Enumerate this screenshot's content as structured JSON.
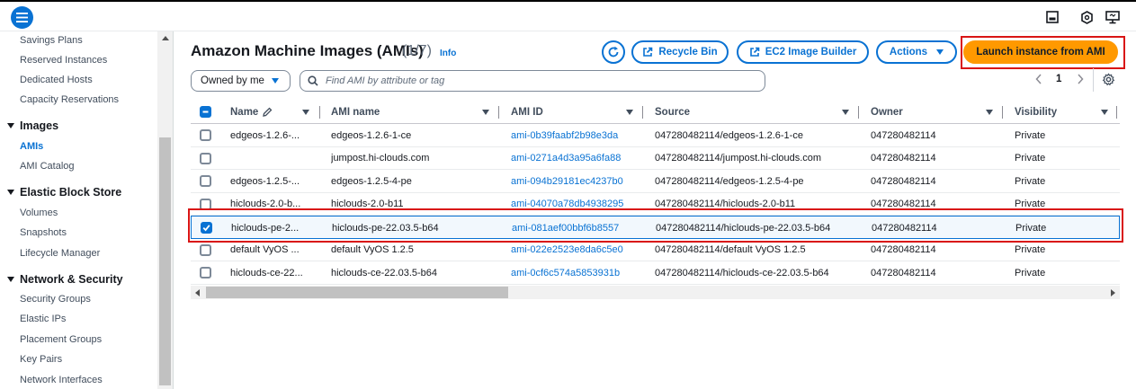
{
  "sidebar": {
    "items_top": [
      "Savings Plans",
      "Reserved Instances",
      "Dedicated Hosts",
      "Capacity Reservations"
    ],
    "images": {
      "title": "Images",
      "items": [
        "AMIs",
        "AMI Catalog"
      ],
      "active": "AMIs"
    },
    "ebs": {
      "title": "Elastic Block Store",
      "items": [
        "Volumes",
        "Snapshots",
        "Lifecycle Manager"
      ]
    },
    "network": {
      "title": "Network & Security",
      "items": [
        "Security Groups",
        "Elastic IPs",
        "Placement Groups",
        "Key Pairs",
        "Network Interfaces"
      ]
    }
  },
  "header": {
    "title": "Amazon Machine Images (AMIs)",
    "count": "(1/7)",
    "info": "Info",
    "buttons": {
      "recycle_bin": "Recycle Bin",
      "image_builder": "EC2 Image Builder",
      "actions": "Actions",
      "launch": "Launch instance from AMI"
    }
  },
  "filter": {
    "owned_by": "Owned by me",
    "search_placeholder": "Find AMI by attribute or tag"
  },
  "pagination": {
    "current_page": "1"
  },
  "table": {
    "columns": [
      "Name",
      "AMI name",
      "AMI ID",
      "Source",
      "Owner",
      "Visibility"
    ],
    "rows": [
      {
        "name": "edgeos-1.2.6-...",
        "ami_name": "edgeos-1.2.6-1-ce",
        "ami_id": "ami-0b39faabf2b98e3da",
        "source": "047280482114/edgeos-1.2.6-1-ce",
        "owner": "047280482114",
        "visibility": "Private",
        "selected": false
      },
      {
        "name": "",
        "ami_name": "jumpost.hi-clouds.com",
        "ami_id": "ami-0271a4d3a95a6fa88",
        "source": "047280482114/jumpost.hi-clouds.com",
        "owner": "047280482114",
        "visibility": "Private",
        "selected": false
      },
      {
        "name": "edgeos-1.2.5-...",
        "ami_name": "edgeos-1.2.5-4-pe",
        "ami_id": "ami-094b29181ec4237b0",
        "source": "047280482114/edgeos-1.2.5-4-pe",
        "owner": "047280482114",
        "visibility": "Private",
        "selected": false
      },
      {
        "name": "hiclouds-2.0-b...",
        "ami_name": "hiclouds-2.0-b11",
        "ami_id": "ami-04070a78db4938295",
        "source": "047280482114/hiclouds-2.0-b11",
        "owner": "047280482114",
        "visibility": "Private",
        "selected": false
      },
      {
        "name": "hiclouds-pe-2...",
        "ami_name": "hiclouds-pe-22.03.5-b64",
        "ami_id": "ami-081aef00bbf6b8557",
        "source": "047280482114/hiclouds-pe-22.03.5-b64",
        "owner": "047280482114",
        "visibility": "Private",
        "selected": true
      },
      {
        "name": "default VyOS ...",
        "ami_name": "default VyOS 1.2.5",
        "ami_id": "ami-022e2523e8da6c5e0",
        "source": "047280482114/default VyOS 1.2.5",
        "owner": "047280482114",
        "visibility": "Private",
        "selected": false
      },
      {
        "name": "hiclouds-ce-22...",
        "ami_name": "hiclouds-ce-22.03.5-b64",
        "ami_id": "ami-0cf6c574a5853931b",
        "source": "047280482114/hiclouds-ce-22.03.5-b64",
        "owner": "047280482114",
        "visibility": "Private",
        "selected": false
      }
    ]
  },
  "colors": {
    "accent": "#0972d3",
    "primary": "#ff9900",
    "highlight": "#d91515",
    "selected_bg": "#f2f8fd"
  },
  "icons": {
    "menu": "hamburger-menu-icon",
    "refresh": "refresh-icon",
    "external": "external-link-icon",
    "search": "search-icon",
    "settings": "gear-icon",
    "edit": "pencil-icon"
  }
}
